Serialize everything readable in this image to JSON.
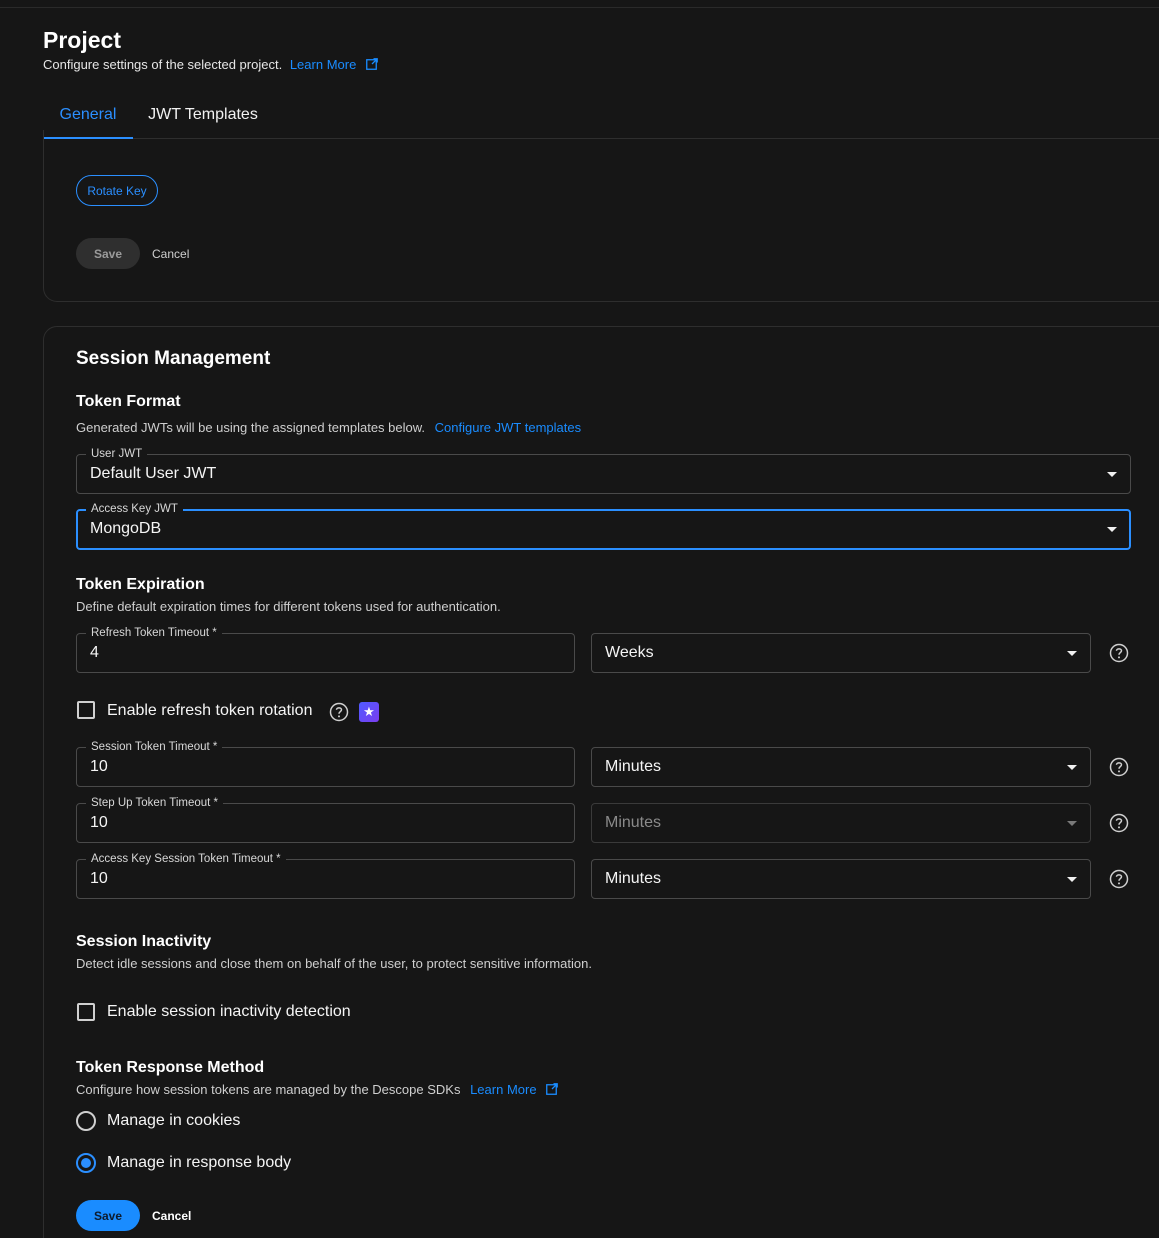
{
  "header": {
    "title": "Project",
    "subtitle": "Configure settings of the selected project.",
    "learn_more": "Learn More"
  },
  "tabs": [
    {
      "label": "General",
      "active": true
    },
    {
      "label": "JWT Templates",
      "active": false
    }
  ],
  "key_card": {
    "rotate_key_label": "Rotate Key",
    "save_label": "Save",
    "cancel_label": "Cancel"
  },
  "session": {
    "title": "Session Management",
    "token_format": {
      "title": "Token Format",
      "description": "Generated JWTs will be using the assigned templates below.",
      "configure_link": "Configure JWT templates",
      "user_jwt": {
        "label": "User JWT",
        "value": "Default User JWT"
      },
      "access_key_jwt": {
        "label": "Access Key JWT",
        "value": "MongoDB"
      }
    },
    "token_expiration": {
      "title": "Token Expiration",
      "description": "Define default expiration times for different tokens used for authentication.",
      "refresh": {
        "label": "Refresh Token Timeout *",
        "value": "4",
        "unit": "Weeks"
      },
      "rotation_label": "Enable refresh token rotation",
      "session_token": {
        "label": "Session Token Timeout *",
        "value": "10",
        "unit": "Minutes"
      },
      "step_up": {
        "label": "Step Up Token Timeout *",
        "value": "10",
        "unit": "Minutes"
      },
      "access_key_session": {
        "label": "Access Key Session Token Timeout *",
        "value": "10",
        "unit": "Minutes"
      }
    },
    "inactivity": {
      "title": "Session Inactivity",
      "description": "Detect idle sessions and close them on behalf of the user, to protect sensitive information.",
      "checkbox_label": "Enable session inactivity detection"
    },
    "response_method": {
      "title": "Token Response Method",
      "description": "Configure how session tokens are managed by the Descope SDKs",
      "learn_more": "Learn More",
      "option_cookies": "Manage in cookies",
      "option_body": "Manage in response body",
      "selected": "Manage in response body"
    },
    "save_label": "Save",
    "cancel_label": "Cancel"
  },
  "colors": {
    "background": "#161616",
    "accent": "#2b8fff",
    "border": "#4a4a4a"
  }
}
